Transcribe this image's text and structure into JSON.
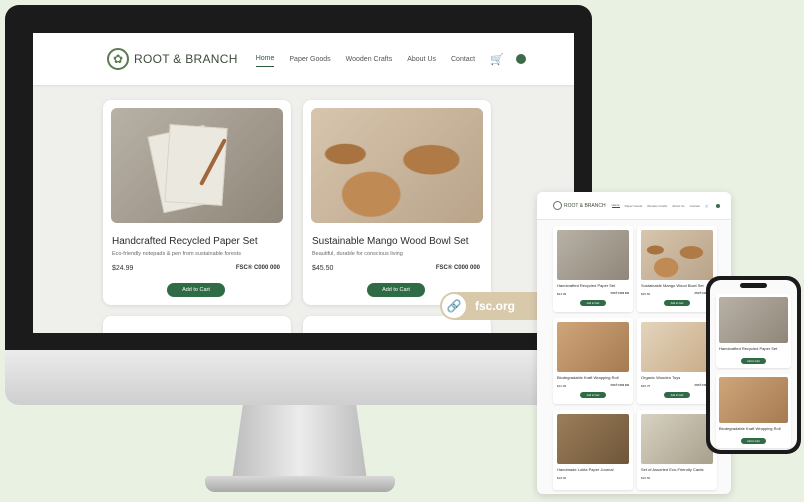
{
  "brand": "ROOT & BRANCH",
  "nav": {
    "links": [
      "Home",
      "Paper Goods",
      "Wooden Crafts",
      "About Us",
      "Contact"
    ],
    "active": "Home"
  },
  "desktop_products": [
    {
      "title": "Handcrafted Recycled Paper Set",
      "description": "Eco-friendly notepads & pen from sustainable forests",
      "price": "$24.99",
      "cert": "FSC® C000 000",
      "button": "Add to Cart"
    },
    {
      "title": "Sustainable Mango Wood Bowl Set",
      "description": "Beautiful, durable for conscious living",
      "price": "$45.50",
      "cert": "FSC® C000 000",
      "button": "Add to Cart"
    }
  ],
  "badge": {
    "text": "fsc.org"
  },
  "tablet_products": [
    {
      "title": "Handcrafted Recycled Paper Set",
      "price": "$24.99",
      "cert": "FSC® C000 000",
      "button": "Add to Cart"
    },
    {
      "title": "Sustainable Mango Wood Bowl Set",
      "price": "$45.50",
      "cert": "FSC® C000 000",
      "button": "Add to Cart"
    },
    {
      "title": "Biodegradable Kraft Wrapping Roll",
      "price": "$12.99",
      "cert": "FSC® C000 000",
      "button": "Add to Cart"
    },
    {
      "title": "Organic Wooden Toys",
      "price": "$35.75",
      "cert": "FSC® C000 000",
      "button": "Add to Cart"
    },
    {
      "title": "Handmade Lokta Paper Journal",
      "price": "$18.00",
      "cert": "",
      "button": ""
    },
    {
      "title": "Set of Assorted Eco-Friendly Cards",
      "price": "$16.50",
      "cert": "",
      "button": ""
    }
  ],
  "phone_products": [
    {
      "title": "Handcrafted Recycled Paper Set",
      "button": "Add to Cart"
    },
    {
      "title": "Biodegradable Kraft Wrapping Roll",
      "button": "Add to Cart"
    }
  ]
}
